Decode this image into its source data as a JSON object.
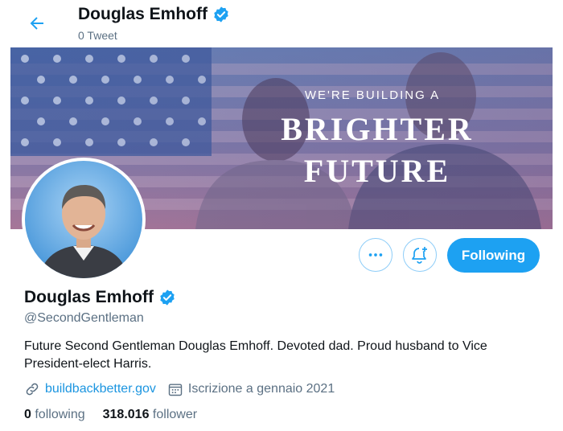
{
  "header": {
    "name": "Douglas Emhoff",
    "tweets": "0 Tweet"
  },
  "banner": {
    "line1": "WE'RE BUILDING A",
    "line2": "BRIGHTER",
    "line3": "FUTURE"
  },
  "actions": {
    "follow_label": "Following"
  },
  "profile": {
    "name": "Douglas Emhoff",
    "handle": "@SecondGentleman",
    "bio": "Future Second Gentleman Douglas Emhoff. Devoted dad. Proud husband to Vice President-elect Harris.",
    "website": "buildbackbetter.gov",
    "joined": "Iscrizione a gennaio 2021",
    "following_count": "0",
    "following_label": "following",
    "followers_count": "318.016",
    "followers_label": "follower"
  },
  "icons": {
    "back": "arrow-left-icon",
    "verified": "verified-badge-icon",
    "more": "more-dots-icon",
    "notify": "bell-plus-icon",
    "link": "link-icon",
    "calendar": "calendar-icon"
  },
  "colors": {
    "accent": "#1da1f2",
    "link": "#1b95e0",
    "muted": "#5b7083"
  }
}
